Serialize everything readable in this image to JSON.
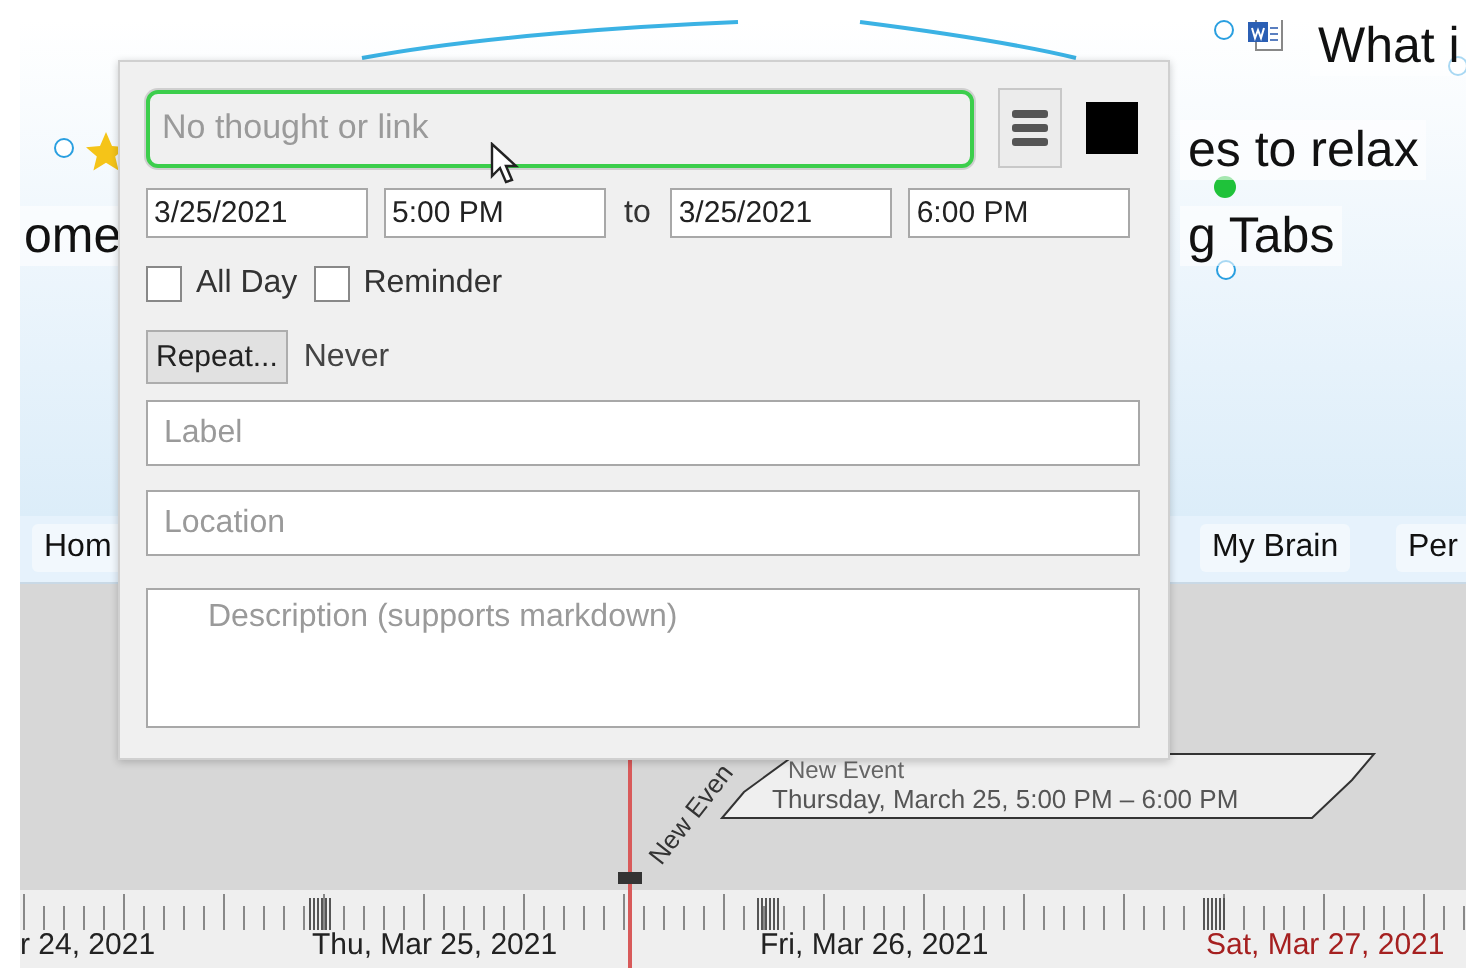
{
  "mind_map": {
    "thoughts": [
      {
        "kind": "document",
        "text": "What i"
      },
      {
        "kind": "star",
        "text": "es to relax"
      },
      {
        "kind": "plain",
        "text": "g Tabs"
      },
      {
        "kind": "plain",
        "text": "ome"
      }
    ]
  },
  "pinned": [
    {
      "label": "Hom"
    },
    {
      "label": "My Brain"
    },
    {
      "label": "Per"
    }
  ],
  "event_popup": {
    "thought_field": {
      "placeholder": "No thought or link"
    },
    "start_date": "3/25/2021",
    "start_time": "5:00 PM",
    "to": "to",
    "end_date": "3/25/2021",
    "end_time": "6:00 PM",
    "options": [
      {
        "label": "All Day",
        "checked": false
      },
      {
        "label": "Reminder",
        "checked": false
      }
    ],
    "repeat_button": "Repeat...",
    "repeat_value": "Never",
    "label_field": {
      "placeholder": "Label"
    },
    "location_field": {
      "placeholder": "Location"
    },
    "description_field": {
      "placeholder": "Description (supports markdown)"
    }
  },
  "timeline": {
    "event_marker": "New Even",
    "event_title": "New Event",
    "event_detail": "Thursday, March 25, 5:00 PM – 6:00 PM",
    "days": [
      {
        "label": "r 24, 2021",
        "weekend": false
      },
      {
        "label": "Thu, Mar 25, 2021",
        "weekend": false
      },
      {
        "label": "Fri, Mar 26, 2021",
        "weekend": false
      },
      {
        "label": "Sat, Mar 27, 2021",
        "weekend": true
      }
    ]
  }
}
